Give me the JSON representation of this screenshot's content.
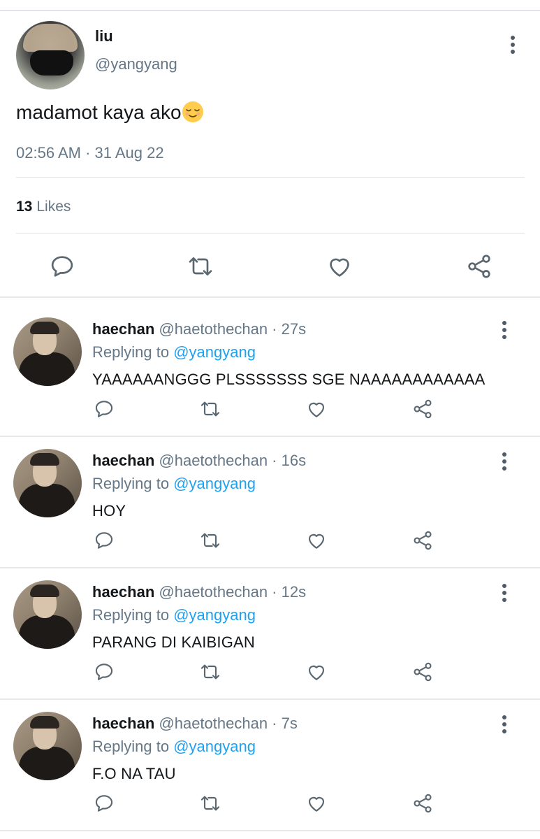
{
  "main_tweet": {
    "name": "liu",
    "handle": "@yangyang",
    "text": "madamot kaya ako",
    "emoji": "relieved-face-emoji",
    "timestamp": "02:56 AM · 31 Aug 22",
    "likes_count": "13",
    "likes_label": "Likes"
  },
  "replies": [
    {
      "name": "haechan",
      "meta": "@haetothechan · 27s",
      "replying_prefix": "Replying to ",
      "replying_to": "@yangyang",
      "text": "YAAAAAANGGG PLSSSSSSS SGE NAAAAAAAAAAAA"
    },
    {
      "name": "haechan",
      "meta": "@haetothechan · 16s",
      "replying_prefix": "Replying to ",
      "replying_to": "@yangyang",
      "text": "HOY"
    },
    {
      "name": "haechan",
      "meta": "@haetothechan · 12s",
      "replying_prefix": "Replying to ",
      "replying_to": "@yangyang",
      "text": "PARANG DI KAIBIGAN"
    },
    {
      "name": "haechan",
      "meta": "@haetothechan · 7s",
      "replying_prefix": "Replying to ",
      "replying_to": "@yangyang",
      "text": "F.O NA TAU"
    }
  ],
  "icons": [
    "reply-icon",
    "retweet-icon",
    "like-icon",
    "share-icon",
    "more-options-icon"
  ],
  "colors": {
    "link": "#1da1f2",
    "secondary_text": "#657786",
    "icon": "#5b6770"
  }
}
